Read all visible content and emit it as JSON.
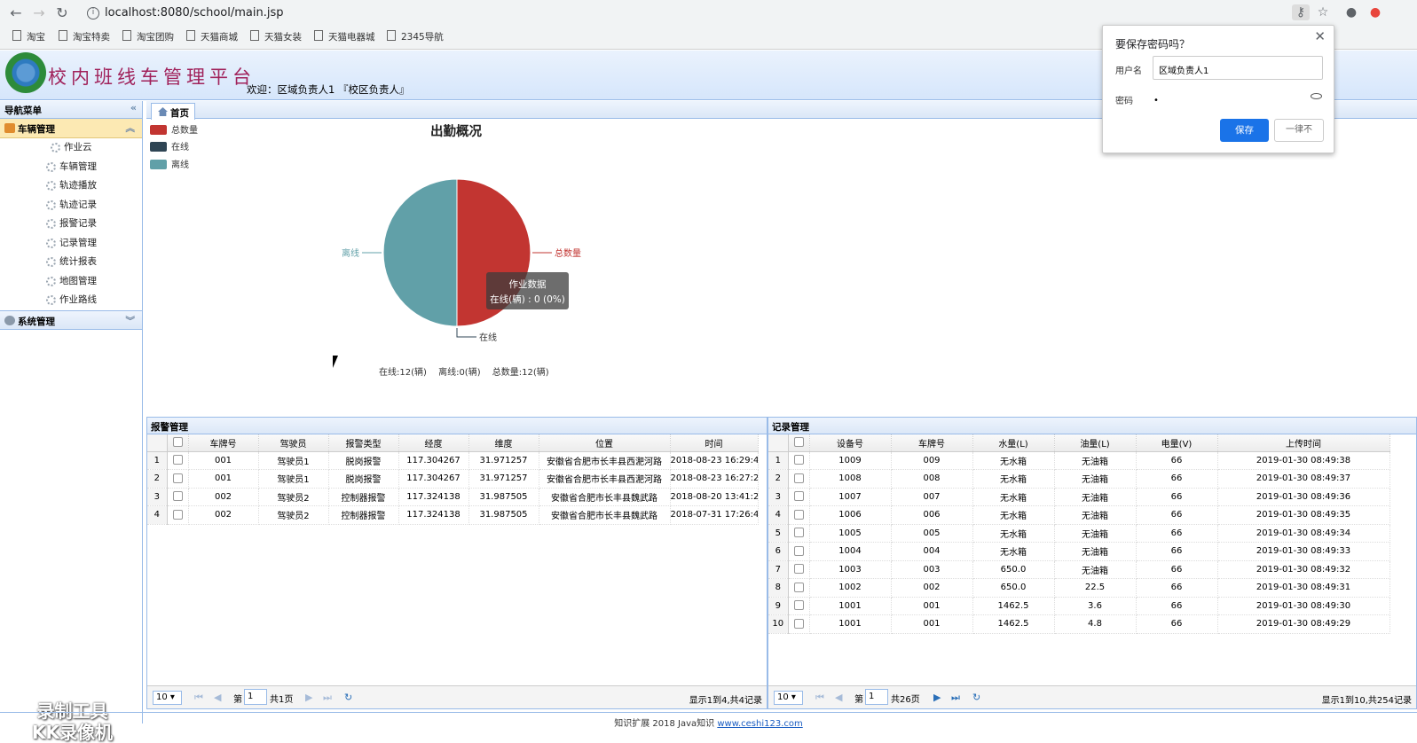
{
  "browser": {
    "url": "localhost:8080/school/main.jsp",
    "bookmarks": [
      "淘宝",
      "淘宝特卖",
      "淘宝团购",
      "天猫商城",
      "天猫女装",
      "天猫电器城",
      "2345导航"
    ]
  },
  "header": {
    "title": "校内班线车管理平台",
    "welcome": "欢迎：区域负责人1 『校区负责人』"
  },
  "sidebar": {
    "title": "导航菜单",
    "group1": "车辆管理",
    "items": [
      "作业云",
      "车辆管理",
      "轨迹播放",
      "轨迹记录",
      "报警记录",
      "记录管理",
      "统计报表",
      "地图管理",
      "作业路线"
    ],
    "group2": "系统管理"
  },
  "tabs": {
    "home": "首页"
  },
  "chart_data": {
    "type": "pie",
    "title": "出勤概况",
    "categories": [
      "总数量",
      "在线",
      "离线"
    ],
    "values": [
      12,
      0,
      12
    ],
    "colors": [
      "#c23531",
      "#2f4554",
      "#61a0a8"
    ],
    "legend": [
      "总数量",
      "在线",
      "离线"
    ],
    "tooltip_title": "作业数据",
    "tooltip_text": "在线(辆) : 0 (0%)",
    "summary": "在线:12(辆)  离线:0(辆)  总数量:12(辆)"
  },
  "password_dialog": {
    "title": "要保存密码吗？",
    "username_label": "用户名",
    "username_value": "区域负责人1",
    "password_label": "密码",
    "password_value": "•",
    "save": "保存",
    "never": "一律不"
  },
  "alarm_panel": {
    "title": "报警管理",
    "columns": [
      "车牌号",
      "驾驶员",
      "报警类型",
      "经度",
      "维度",
      "位置",
      "时间"
    ],
    "rows": [
      [
        "1",
        "001",
        "驾驶员1",
        "脱岗报警",
        "117.304267",
        "31.971257",
        "安徽省合肥市长丰县西淝河路",
        "2018-08-23 16:29:4"
      ],
      [
        "2",
        "001",
        "驾驶员1",
        "脱岗报警",
        "117.304267",
        "31.971257",
        "安徽省合肥市长丰县西淝河路",
        "2018-08-23 16:27:2"
      ],
      [
        "3",
        "002",
        "驾驶员2",
        "控制器报警",
        "117.324138",
        "31.987505",
        "安徽省合肥市长丰县魏武路",
        "2018-08-20 13:41:2"
      ],
      [
        "4",
        "002",
        "驾驶员2",
        "控制器报警",
        "117.324138",
        "31.987505",
        "安徽省合肥市长丰县魏武路",
        "2018-07-31 17:26:4"
      ]
    ],
    "page_size": "10",
    "page_prefix": "第",
    "page_value": "1",
    "page_total": "共1页",
    "info": "显示1到4,共4记录"
  },
  "record_panel": {
    "title": "记录管理",
    "columns": [
      "设备号",
      "车牌号",
      "水量(L)",
      "油量(L)",
      "电量(V)",
      "上传时间"
    ],
    "rows": [
      [
        "1",
        "1009",
        "009",
        "无水箱",
        "无油箱",
        "66",
        "2019-01-30 08:49:38"
      ],
      [
        "2",
        "1008",
        "008",
        "无水箱",
        "无油箱",
        "66",
        "2019-01-30 08:49:37"
      ],
      [
        "3",
        "1007",
        "007",
        "无水箱",
        "无油箱",
        "66",
        "2019-01-30 08:49:36"
      ],
      [
        "4",
        "1006",
        "006",
        "无水箱",
        "无油箱",
        "66",
        "2019-01-30 08:49:35"
      ],
      [
        "5",
        "1005",
        "005",
        "无水箱",
        "无油箱",
        "66",
        "2019-01-30 08:49:34"
      ],
      [
        "6",
        "1004",
        "004",
        "无水箱",
        "无油箱",
        "66",
        "2019-01-30 08:49:33"
      ],
      [
        "7",
        "1003",
        "003",
        "650.0",
        "无油箱",
        "66",
        "2019-01-30 08:49:32"
      ],
      [
        "8",
        "1002",
        "002",
        "650.0",
        "22.5",
        "66",
        "2019-01-30 08:49:31"
      ],
      [
        "9",
        "1001",
        "001",
        "1462.5",
        "3.6",
        "66",
        "2019-01-30 08:49:30"
      ],
      [
        "10",
        "1001",
        "001",
        "1462.5",
        "4.8",
        "66",
        "2019-01-30 08:49:29"
      ]
    ],
    "page_size": "10",
    "page_prefix": "第",
    "page_value": "1",
    "page_total": "共26页",
    "info": "显示1到10,共254记录"
  },
  "footer": {
    "text": "知识扩展 2018 Java知识 ",
    "link": "www.ceshi123.com"
  },
  "watermark": {
    "line1": "录制工具",
    "line2": "KK录像机"
  }
}
